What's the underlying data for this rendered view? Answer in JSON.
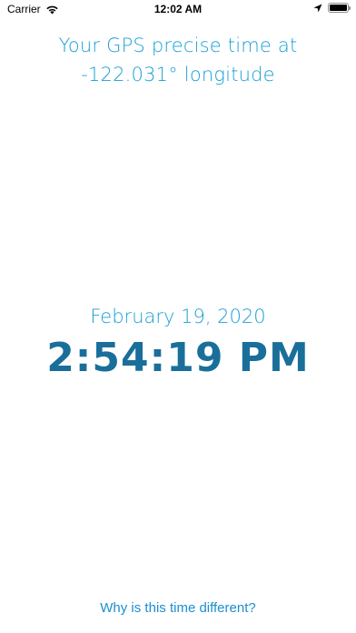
{
  "status_bar": {
    "carrier": "Carrier",
    "time": "12:02 AM",
    "battery_level": 1.0,
    "icons": [
      "wifi-icon",
      "location-arrow-icon",
      "battery-icon"
    ]
  },
  "header": {
    "line1": "Your GPS precise time at",
    "line2": "-122.031° longitude"
  },
  "clock": {
    "date": "February 19, 2020",
    "time": "2:54:19 PM"
  },
  "footer": {
    "link_label": "Why is this time different?"
  },
  "colors": {
    "accent_light": "#1a9fd6",
    "accent_dark": "#1a6f9a",
    "link": "#1a8fcf",
    "background": "#ffffff"
  }
}
